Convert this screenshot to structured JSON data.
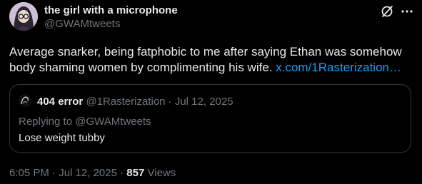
{
  "tweet": {
    "author": {
      "display_name": "the girl with a microphone",
      "handle": "@GWAMtweets"
    },
    "text": "Average snarker, being fatphobic to me after saying Ethan was somehow body shaming women by complimenting his wife.",
    "link_text": "x.com/1Rasterization…",
    "time": "6:05 PM",
    "date": "Jul 12, 2025",
    "views_count": "857",
    "views_label": "Views",
    "separator": "·"
  },
  "quote": {
    "author": {
      "display_name": "404 error",
      "handle": "@1Rasterization"
    },
    "separator": "·",
    "date": "Jul 12, 2025",
    "replying_to_label": "Replying to",
    "replying_to_handle": "@GWAMtweets",
    "text": "Lose weight tubby"
  },
  "icons": {
    "grok": "grok-icon",
    "more": "more-icon"
  },
  "colors": {
    "background": "#000000",
    "text": "#e7e9ea",
    "secondary": "#71767b",
    "link": "#1d9bf0",
    "border": "#2f3336"
  }
}
